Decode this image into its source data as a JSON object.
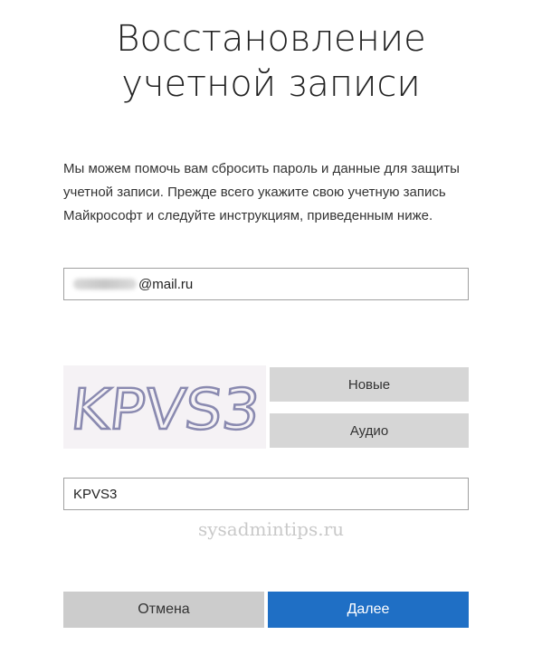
{
  "header": {
    "title_line1": "Восстановление",
    "title_line2": "учетной записи"
  },
  "description": "Мы можем помочь вам сбросить пароль и данные для защиты учетной записи. Прежде всего укажите свою учетную запись Майкрософт и следуйте инструкциям, приведенным ниже.",
  "email_field": {
    "value_domain": "@mail.ru"
  },
  "captcha": {
    "image_text": "KPVS3",
    "new_label": "Новые",
    "audio_label": "Аудио",
    "input_value": "KPVS3"
  },
  "watermark": "sysadmintips.ru",
  "actions": {
    "cancel_label": "Отмена",
    "next_label": "Далее"
  },
  "colors": {
    "primary": "#1f6fc5",
    "secondary_button": "#d6d6d6",
    "captcha_stroke": "#8a8ab0"
  }
}
